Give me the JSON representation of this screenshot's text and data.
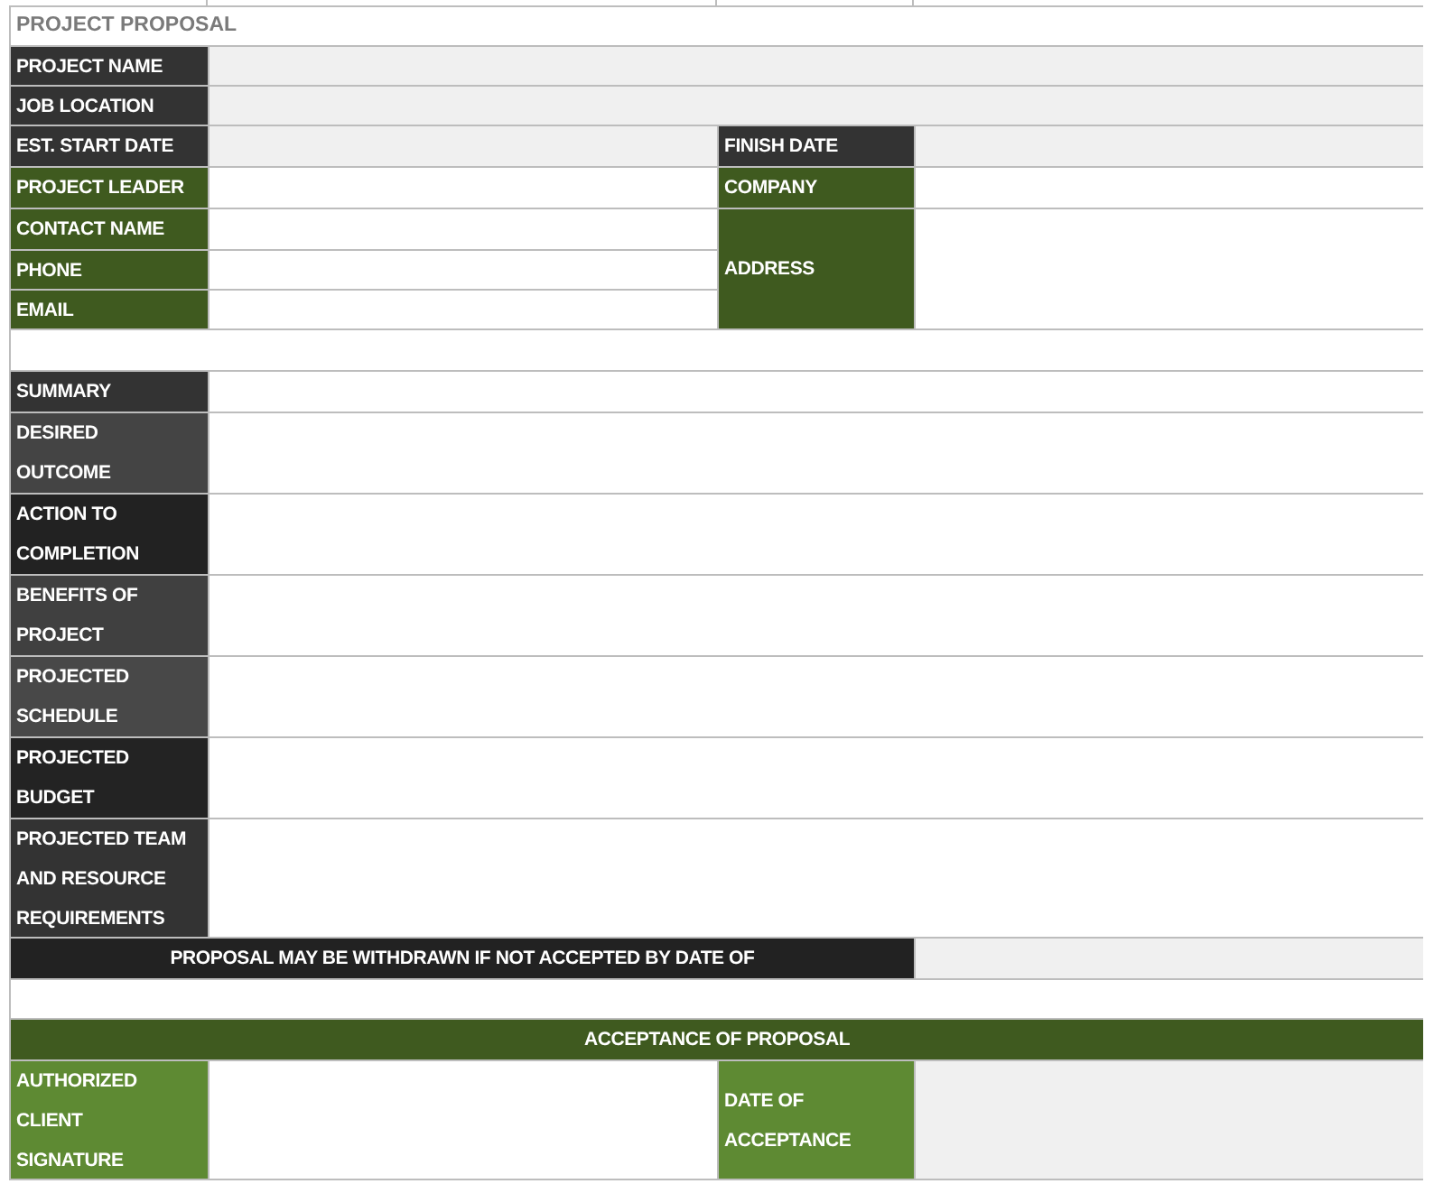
{
  "title": "PROJECT PROPOSAL",
  "project_fields": [
    {
      "label": "PROJECT NAME"
    },
    {
      "label": "JOB LOCATION"
    }
  ],
  "dates": {
    "start_label": "EST. START DATE",
    "finish_label": "FINISH DATE"
  },
  "contact": {
    "project_leader": "PROJECT LEADER",
    "company": "COMPANY",
    "contact_name": "CONTACT NAME",
    "address": "ADDRESS",
    "phone": "PHONE",
    "email": "EMAIL"
  },
  "sections": [
    {
      "label": "SUMMARY",
      "color": "#333333"
    },
    {
      "label": "DESIRED\nOUTCOME",
      "color": "#444444"
    },
    {
      "label": "ACTION TO\nCOMPLETION",
      "color": "#222222"
    },
    {
      "label": "BENEFITS OF\nPROJECT",
      "color": "#404040"
    },
    {
      "label": "PROJECTED\nSCHEDULE",
      "color": "#484848"
    },
    {
      "label": "PROJECTED\nBUDGET",
      "color": "#232323"
    },
    {
      "label": "PROJECTED TEAM\nAND RESOURCE\nREQUIREMENTS",
      "color": "#333333"
    }
  ],
  "withdrawal_notice": "PROPOSAL MAY BE WITHDRAWN IF NOT ACCEPTED BY DATE OF",
  "acceptance": {
    "heading": "ACCEPTANCE OF PROPOSAL",
    "signature_label": "AUTHORIZED\nCLIENT\nSIGNATURE",
    "date_label": "DATE OF\nACCEPTANCE"
  }
}
